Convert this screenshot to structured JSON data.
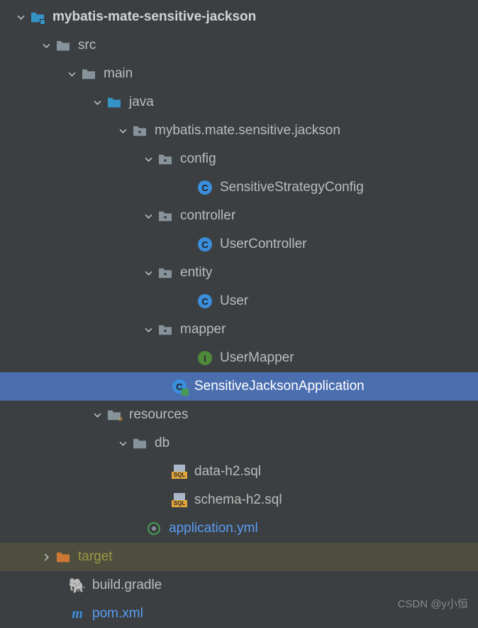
{
  "tree": {
    "root": {
      "label": "mybatis-mate-sensitive-jackson"
    },
    "src": {
      "label": "src"
    },
    "main": {
      "label": "main"
    },
    "java": {
      "label": "java"
    },
    "pkg": {
      "label": "mybatis.mate.sensitive.jackson"
    },
    "config": {
      "label": "config"
    },
    "config_file": {
      "label": "SensitiveStrategyConfig"
    },
    "controller": {
      "label": "controller"
    },
    "controller_file": {
      "label": "UserController"
    },
    "entity": {
      "label": "entity"
    },
    "entity_file": {
      "label": "User"
    },
    "mapper": {
      "label": "mapper"
    },
    "mapper_file": {
      "label": "UserMapper"
    },
    "app_file": {
      "label": "SensitiveJacksonApplication"
    },
    "resources": {
      "label": "resources"
    },
    "db": {
      "label": "db"
    },
    "data_sql": {
      "label": "data-h2.sql"
    },
    "schema_sql": {
      "label": "schema-h2.sql"
    },
    "app_yml": {
      "label": "application.yml"
    },
    "target": {
      "label": "target"
    },
    "gradle": {
      "label": "build.gradle"
    },
    "pom": {
      "label": "pom.xml"
    }
  },
  "watermark": "CSDN @y小恒",
  "icon_letters": {
    "class": "C",
    "interface": "I",
    "sql": "SQL"
  }
}
